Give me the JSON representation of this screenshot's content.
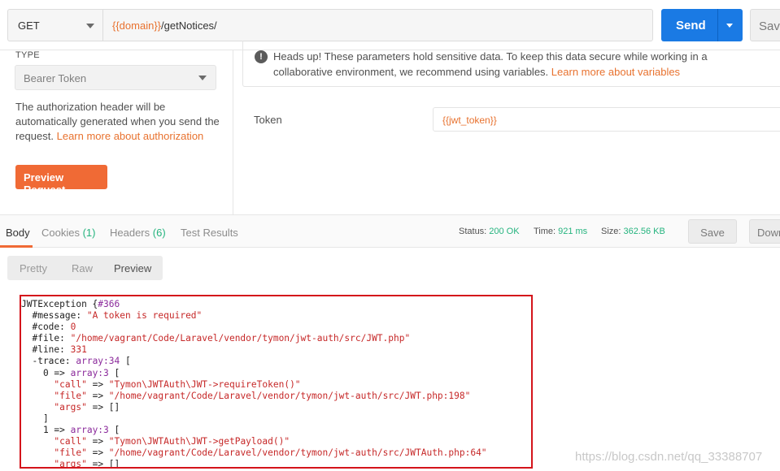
{
  "request": {
    "method": "GET",
    "url_var": "{{domain}}",
    "url_path": "/getNotices/",
    "send_label": "Send",
    "save_label": "Save"
  },
  "auth": {
    "type_label": "TYPE",
    "type_value": "Bearer Token",
    "description": "The authorization header will be automatically generated when you send the request.",
    "description_link": "Learn more about authorization",
    "preview_button": "Preview Request",
    "warning": "Heads up! These parameters hold sensitive data. To keep this data secure while working in a collaborative environment, we recommend using variables.",
    "warning_link": "Learn more about variables",
    "token_label": "Token",
    "token_value": "{{jwt_token}}"
  },
  "response": {
    "tabs": [
      {
        "label": "Body",
        "count": ""
      },
      {
        "label": "Cookies",
        "count": "(1)"
      },
      {
        "label": "Headers",
        "count": "(6)"
      },
      {
        "label": "Test Results",
        "count": ""
      }
    ],
    "status_label": "Status:",
    "status_value": "200 OK",
    "time_label": "Time:",
    "time_value": "921 ms",
    "size_label": "Size:",
    "size_value": "362.56 KB",
    "save_button": "Save",
    "download_button": "Download",
    "views": [
      "Pretty",
      "Raw",
      "Preview"
    ],
    "active_view": "Preview"
  },
  "body_lines": [
    "JWTException {#366",
    "  #message: \"A token is required\"",
    "  #code: 0",
    "  #file: \"/home/vagrant/Code/Laravel/vendor/tymon/jwt-auth/src/JWT.php\"",
    "  #line: 331",
    "  -trace: array:34 [",
    "    0 => array:3 [",
    "      \"call\" => \"Tymon\\JWTAuth\\JWT->requireToken()\"",
    "      \"file\" => \"/home/vagrant/Code/Laravel/vendor/tymon/jwt-auth/src/JWT.php:198\"",
    "      \"args\" => []",
    "    ]",
    "    1 => array:3 [",
    "      \"call\" => \"Tymon\\JWTAuth\\JWT->getPayload()\"",
    "      \"file\" => \"/home/vagrant/Code/Laravel/vendor/tymon/jwt-auth/src/JWTAuth.php:64\"",
    "      \"args\" => []"
  ],
  "watermark": "https://blog.csdn.net/qq_33388707"
}
